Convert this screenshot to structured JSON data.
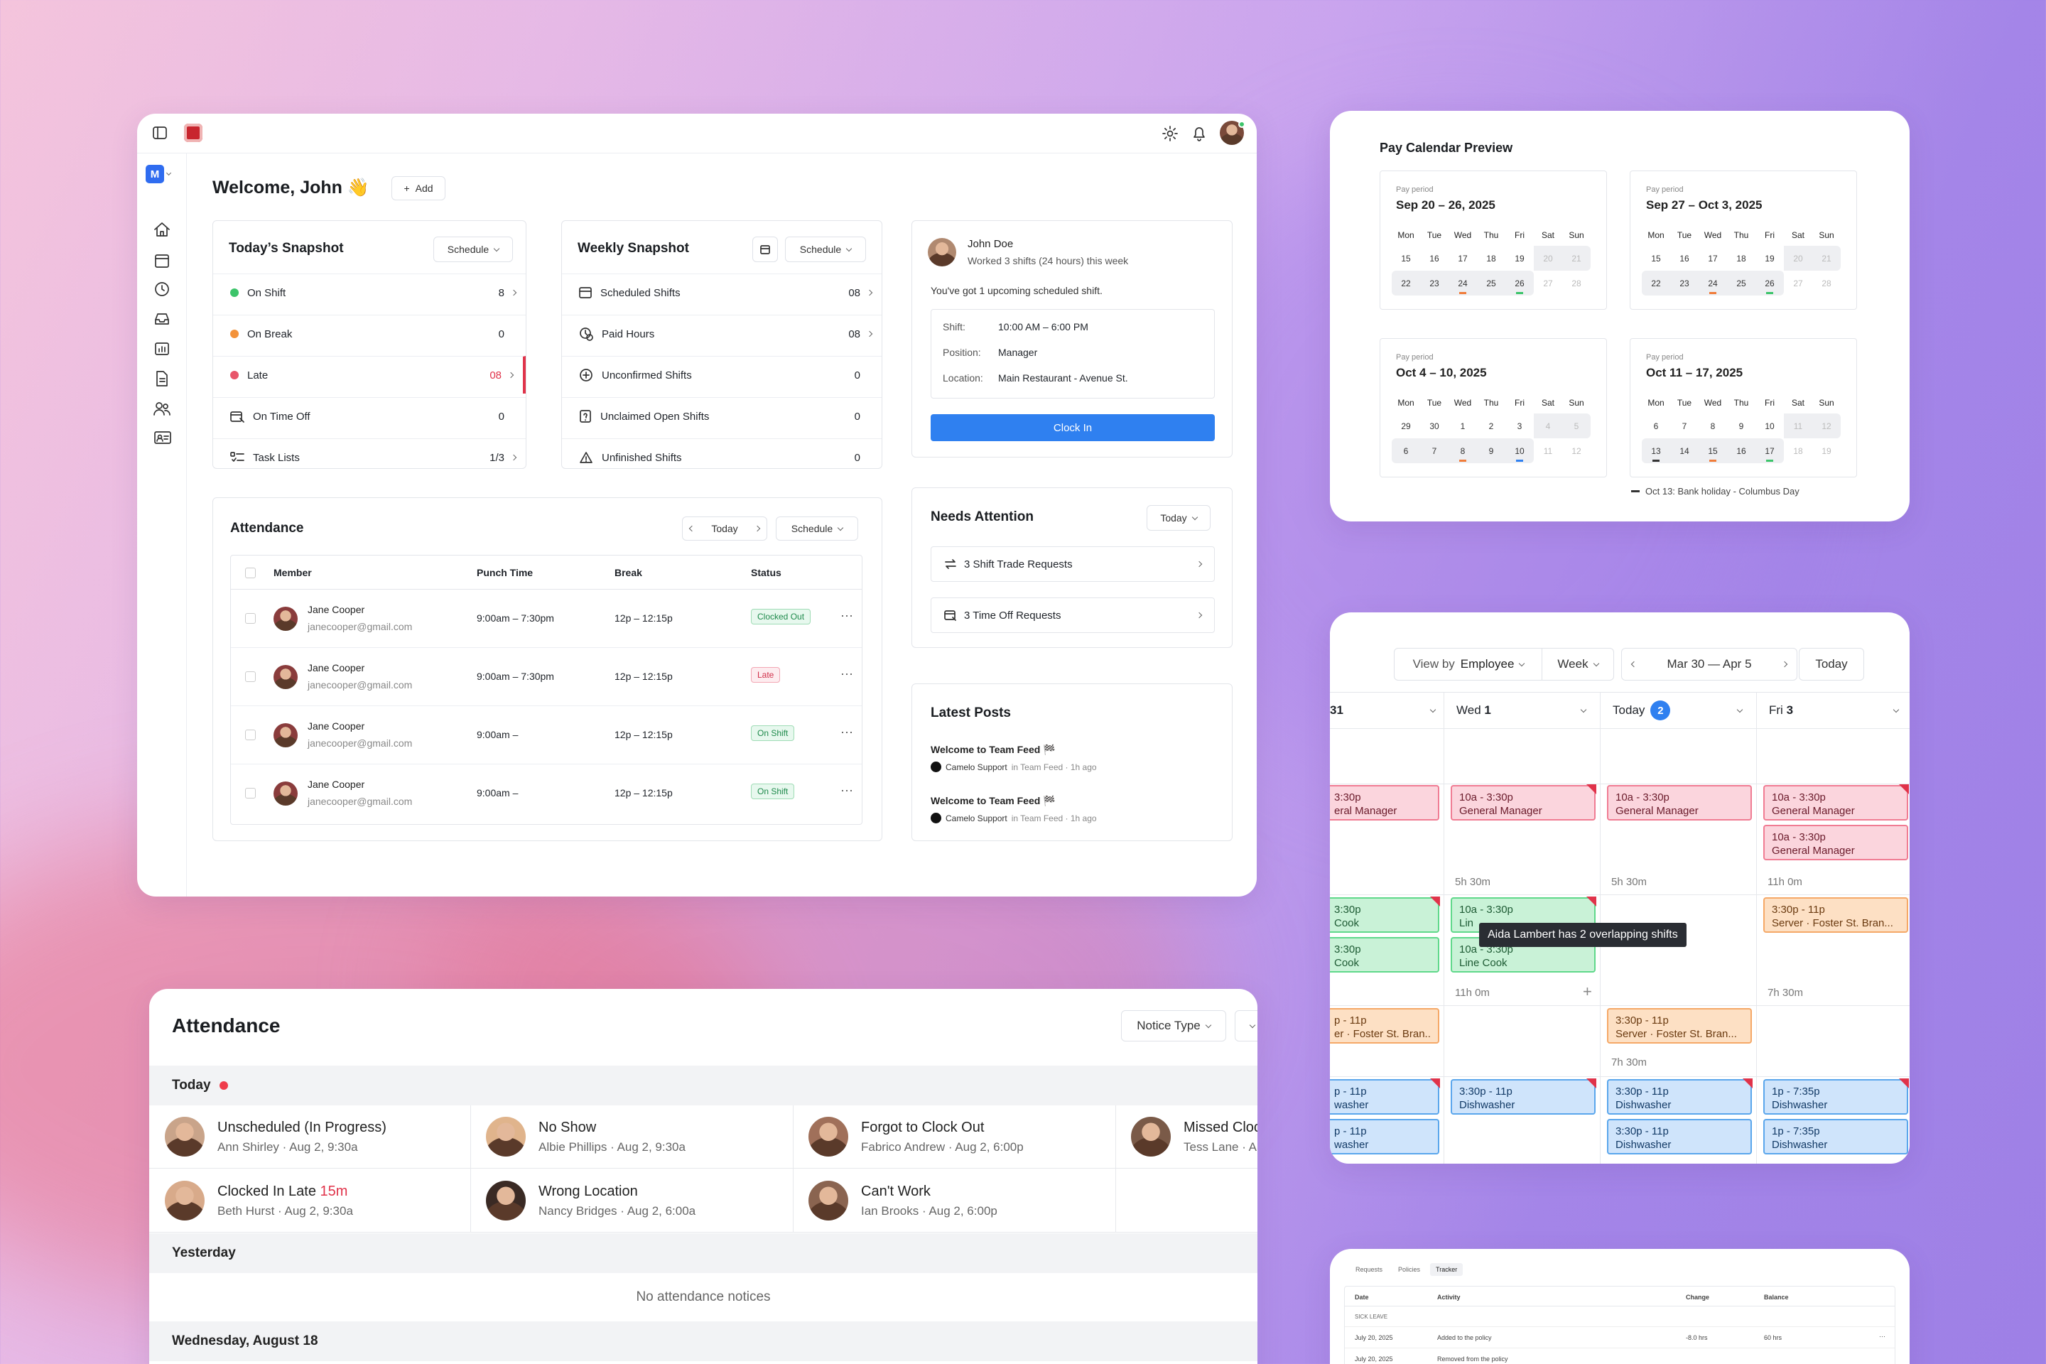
{
  "dashboard": {
    "welcome": "Welcome, John 👋",
    "add_label": "Add",
    "workspace_initial": "M",
    "todays_snapshot": {
      "title": "Today’s Snapshot",
      "dropdown": "Schedule",
      "rows": [
        {
          "label": "On Shift",
          "value": "8",
          "color": "#3cc46a"
        },
        {
          "label": "On Break",
          "value": "0",
          "color": "#f3923a"
        },
        {
          "label": "Late",
          "value": "08",
          "color": "#e8556a"
        },
        {
          "label": "On Time Off",
          "value": "0"
        },
        {
          "label": "Task Lists",
          "value": "1/3"
        }
      ]
    },
    "weekly_snapshot": {
      "title": "Weekly Snapshot",
      "dropdown": "Schedule",
      "rows": [
        {
          "label": "Scheduled Shifts",
          "value": "08"
        },
        {
          "label": "Paid Hours",
          "value": "08"
        },
        {
          "label": "Unconfirmed Shifts",
          "value": "0"
        },
        {
          "label": "Unclaimed Open Shifts",
          "value": "0"
        },
        {
          "label": "Unfinished Shifts",
          "value": "0"
        }
      ]
    },
    "profile": {
      "name": "John Doe",
      "summary": "Worked 3 shifts (24 hours) this week",
      "upcoming": "You've got 1 upcoming scheduled shift.",
      "shift_label": "Shift:",
      "shift_value": "10:00 AM – 6:00 PM",
      "position_label": "Position:",
      "position_value": "Manager",
      "location_label": "Location:",
      "location_value": "Main Restaurant - Avenue St.",
      "clock_in": "Clock In"
    },
    "attendance": {
      "title": "Attendance",
      "today": "Today",
      "dropdown": "Schedule",
      "columns": [
        "Member",
        "Punch Time",
        "Break",
        "Status"
      ],
      "rows": [
        {
          "name": "Jane Cooper",
          "email": "janecooper@gmail.com",
          "punch": "9:00am – 7:30pm",
          "break": "12p – 12:15p",
          "status": "Clocked Out"
        },
        {
          "name": "Jane Cooper",
          "email": "janecooper@gmail.com",
          "punch": "9:00am – 7:30pm",
          "break": "12p – 12:15p",
          "status": "Late"
        },
        {
          "name": "Jane Cooper",
          "email": "janecooper@gmail.com",
          "punch": "9:00am –",
          "break": "12p – 12:15p",
          "status": "On Shift"
        },
        {
          "name": "Jane Cooper",
          "email": "janecooper@gmail.com",
          "punch": "9:00am –",
          "break": "12p – 12:15p",
          "status": "On Shift"
        }
      ]
    },
    "needs_attention": {
      "title": "Needs Attention",
      "dropdown": "Today",
      "items": [
        "3 Shift Trade Requests",
        "3 Time Off Requests"
      ]
    },
    "latest_posts": {
      "title": "Latest Posts",
      "posts": [
        {
          "title": "Welcome to Team Feed 🏁",
          "author": "Camelo Support",
          "meta": "in Team Feed · 1h ago"
        },
        {
          "title": "Welcome to Team Feed 🏁",
          "author": "Camelo Support",
          "meta": "in Team Feed · 1h ago"
        }
      ]
    }
  },
  "pay_calendar": {
    "title": "Pay Calendar Preview",
    "period_label": "Pay period",
    "days": [
      "Mon",
      "Tue",
      "Wed",
      "Thu",
      "Fri",
      "Sat",
      "Sun"
    ],
    "periods": [
      {
        "range": "Sep 20 – 26, 2025",
        "weeks": [
          [
            "15",
            "16",
            "17",
            "18",
            "19",
            "20",
            "21"
          ],
          [
            "22",
            "23",
            "24",
            "25",
            "26",
            "27",
            "28"
          ]
        ]
      },
      {
        "range": "Sep 27 – Oct 3, 2025",
        "weeks": [
          [
            "15",
            "16",
            "17",
            "18",
            "19",
            "20",
            "21"
          ],
          [
            "22",
            "23",
            "24",
            "25",
            "26",
            "27",
            "28"
          ]
        ]
      },
      {
        "range": "Oct 4 – 10, 2025",
        "weeks": [
          [
            "29",
            "30",
            "1",
            "2",
            "3",
            "4",
            "5"
          ],
          [
            "6",
            "7",
            "8",
            "9",
            "10",
            "11",
            "12"
          ]
        ]
      },
      {
        "range": "Oct 11 – 17, 2025",
        "weeks": [
          [
            "6",
            "7",
            "8",
            "9",
            "10",
            "11",
            "12"
          ],
          [
            "13",
            "14",
            "15",
            "16",
            "17",
            "18",
            "19"
          ]
        ]
      }
    ],
    "legend": "Oct 13: Bank holiday - Columbus Day"
  },
  "schedule": {
    "view_by_label": "View by",
    "view_by_value": "Employee",
    "range_mode": "Week",
    "date_range": "Mar 30 — Apr 5",
    "today_btn": "Today",
    "columns": [
      {
        "label": "31",
        "bold": ""
      },
      {
        "label": "Wed",
        "bold": "1"
      },
      {
        "label": "Today",
        "badge": "2"
      },
      {
        "label": "Fri",
        "bold": "3"
      }
    ],
    "tooltip": "Aida Lambert has 2 overlapping shifts",
    "hours": [
      "5h 30m",
      "5h 30m",
      "11h 0m",
      "11h 0m",
      "7h 30m",
      "7h 30m"
    ],
    "shifts": {
      "gm_time": "10a - 3:30p",
      "gm_role": "General Manager",
      "gm_partial_time": "3:30p",
      "gm_partial_role": "eral Manager",
      "cook_time": "10a - 3:30p",
      "cook_role": "Line Cook",
      "cook_partial_time": "3:30p",
      "cook_partial_role": "Cook",
      "cook_hidden_role": "Lin",
      "server_time": "3:30p - 11p",
      "server_role": "Server · Foster St. Bran...",
      "server_partial_time": "p - 11p",
      "server_partial_role": "er · Foster St. Bran...",
      "server_long": "Server · Foster St. Bran...",
      "dish_time": "3:30p - 11p",
      "dish_role": "Dishwasher",
      "dish_partial_time": "p - 11p",
      "dish_partial_role": "washer",
      "dish_fri_time": "1p - 7:35p"
    }
  },
  "notices": {
    "title": "Attendance",
    "dropdown": "Notice Type",
    "today_label": "Today",
    "yesterday_label": "Yesterday",
    "empty": "No attendance notices",
    "older_label": "Wednesday, August 18",
    "items": [
      {
        "title": "Unscheduled (In Progress)",
        "sub": "Ann Shirley · Aug 2, 9:30a"
      },
      {
        "title": "No Show",
        "sub": "Albie Phillips · Aug 2, 9:30a"
      },
      {
        "title": "Forgot to Clock Out",
        "sub": "Fabrico Andrew · Aug 2, 6:00p"
      },
      {
        "title": "Missed Cloc",
        "sub": "Tess Lane · Au"
      },
      {
        "title": "Clocked In Late",
        "late": "15m",
        "sub": "Beth Hurst · Aug 2, 9:30a"
      },
      {
        "title": "Wrong Location",
        "sub": "Nancy Bridges · Aug 2, 6:00a"
      },
      {
        "title": "Can't Work",
        "sub": "Ian Brooks · Aug 2, 6:00p"
      }
    ]
  },
  "tracker": {
    "tabs": [
      "Requests",
      "Policies",
      "Tracker"
    ],
    "columns": [
      "Date",
      "Activity",
      "Change",
      "Balance"
    ],
    "section": "SICK LEAVE",
    "rows": [
      {
        "date": "July 20, 2025",
        "activity": "Added to the policy",
        "change": "-8.0 hrs",
        "balance": "60 hrs"
      },
      {
        "date": "July 20, 2025",
        "activity": "Removed from the policy",
        "change": "",
        "balance": ""
      }
    ]
  }
}
